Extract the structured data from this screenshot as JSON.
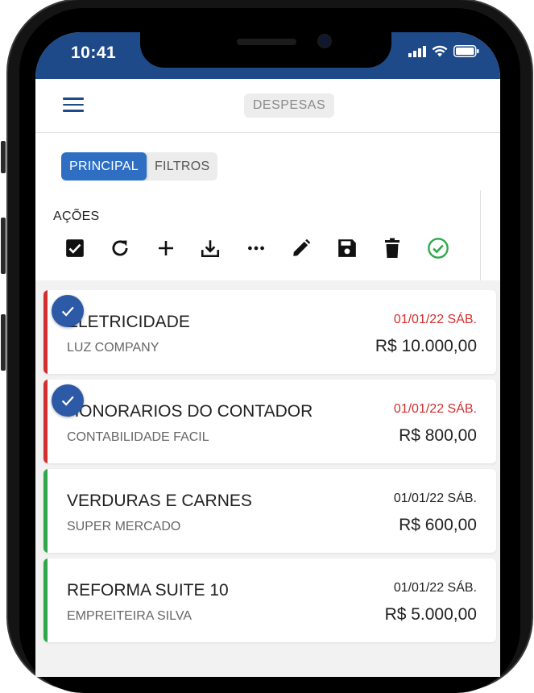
{
  "status_bar": {
    "time": "10:41"
  },
  "header": {
    "title": "DESPESAS"
  },
  "tabs": [
    {
      "label": "PRINCIPAL",
      "active": true
    },
    {
      "label": "FILTROS",
      "active": false
    }
  ],
  "actions": {
    "label": "AÇÕES",
    "tools": [
      {
        "name": "select-all-checkbox-icon"
      },
      {
        "name": "refresh-icon"
      },
      {
        "name": "add-icon"
      },
      {
        "name": "download-icon"
      },
      {
        "name": "more-options-icon"
      },
      {
        "name": "edit-pencil-icon"
      },
      {
        "name": "save-icon"
      },
      {
        "name": "delete-trash-icon"
      },
      {
        "name": "confirm-check-circle-icon"
      }
    ]
  },
  "colors": {
    "header_blue": "#1f4a8a",
    "accent_blue": "#2e6fc4",
    "overdue_red": "#d32f2f",
    "paid_green": "#2ea84b"
  },
  "expenses": [
    {
      "title": "ELETRICIDADE",
      "company": "LUZ COMPANY",
      "date": "01/01/22 SÁB.",
      "amount": "R$ 10.000,00",
      "status": "overdue",
      "selected": true
    },
    {
      "title": "HONORARIOS DO CONTADOR",
      "company": "CONTABILIDADE FACIL",
      "date": "01/01/22 SÁB.",
      "amount": "R$ 800,00",
      "status": "overdue",
      "selected": true
    },
    {
      "title": "VERDURAS E CARNES",
      "company": "SUPER MERCADO",
      "date": "01/01/22 SÁB.",
      "amount": "R$ 600,00",
      "status": "paid",
      "selected": false
    },
    {
      "title": "REFORMA SUITE 10",
      "company": "EMPREITEIRA SILVA",
      "date": "01/01/22 SÁB.",
      "amount": "R$ 5.000,00",
      "status": "paid",
      "selected": false
    }
  ]
}
